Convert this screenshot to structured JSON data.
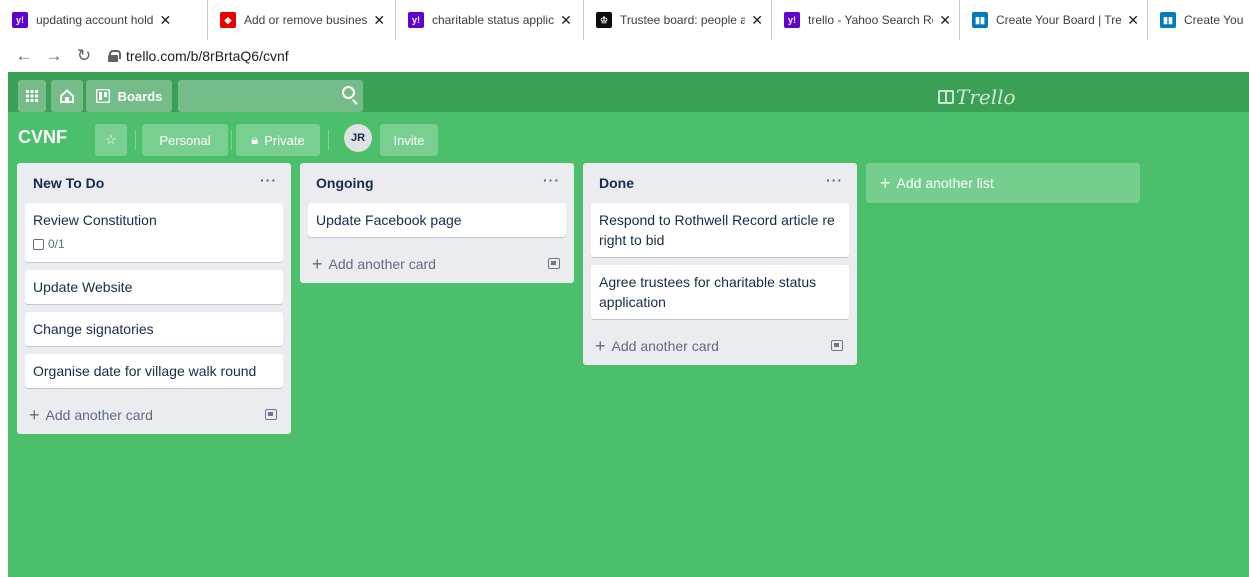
{
  "browser": {
    "tabs": [
      {
        "label": "updating account hold",
        "favicon": "yahoo-icon",
        "color": "#6001d2"
      },
      {
        "label": "Add or remove busines",
        "favicon": "santander-icon",
        "color": "#ec0000"
      },
      {
        "label": "charitable status applic",
        "favicon": "yahoo-icon",
        "color": "#6001d2"
      },
      {
        "label": "Trustee board: people a",
        "favicon": "gov-crown-icon",
        "color": "#0b0c0c"
      },
      {
        "label": "trello - Yahoo Search Re",
        "favicon": "yahoo-icon",
        "color": "#6001d2"
      },
      {
        "label": "Create Your Board | Tre",
        "favicon": "trello-icon",
        "color": "#0079bf"
      },
      {
        "label": "Create You",
        "favicon": "trello-icon",
        "color": "#0079bf"
      }
    ],
    "url": "trello.com/b/8rBrtaQ6/cvnf"
  },
  "header": {
    "boards_label": "Boards",
    "logo_text": "Trello"
  },
  "board": {
    "title": "CVNF",
    "visibility_team": "Personal",
    "visibility_privacy": "Private",
    "member_initials": "JR",
    "invite_label": "Invite"
  },
  "lists": [
    {
      "title": "New To Do",
      "menu": "···",
      "cards": [
        {
          "title": "Review Constitution",
          "checklist": "0/1"
        },
        {
          "title": "Update Website"
        },
        {
          "title": "Change signatories"
        },
        {
          "title": "Organise date for village walk round"
        }
      ],
      "add_card_label": "Add another card"
    },
    {
      "title": "Ongoing",
      "menu": "···",
      "cards": [
        {
          "title": "Update Facebook page"
        }
      ],
      "add_card_label": "Add another card"
    },
    {
      "title": "Done",
      "menu": "···",
      "cards": [
        {
          "title": "Respond to Rothwell Record article re right to bid"
        },
        {
          "title": "Agree trustees for charitable status application"
        }
      ],
      "add_card_label": "Add another card"
    }
  ],
  "add_list_label": "Add another list",
  "colors": {
    "board_background": "#4bbf6b",
    "header_background": "#3aa055",
    "list_background": "#ebecf0"
  }
}
